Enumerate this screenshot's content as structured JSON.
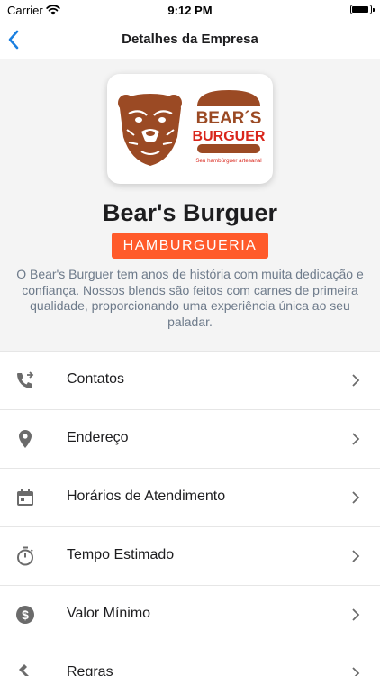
{
  "status_bar": {
    "carrier": "Carrier",
    "time": "9:12 PM",
    "battery_level": 0.92
  },
  "nav": {
    "title": "Detalhes da Empresa"
  },
  "logo": {
    "brand_line1": "BEAR´S",
    "brand_line2": "BURGUER",
    "tagline": "Seu hambúrguer artesanal"
  },
  "company": {
    "name": "Bear's Burguer",
    "category": "HAMBURGUERIA",
    "description": "O Bear's Burguer tem anos de história com muita dedicação e confiança. Nossos blends são feitos com carnes de primeira qualidade, proporcionando uma experiência única ao seu paladar."
  },
  "menu": {
    "items": [
      {
        "label": "Contatos",
        "icon": "phone-forward-icon"
      },
      {
        "label": "Endereço",
        "icon": "location-pin-icon"
      },
      {
        "label": "Horários de Atendimento",
        "icon": "calendar-icon"
      },
      {
        "label": "Tempo Estimado",
        "icon": "timer-icon"
      },
      {
        "label": "Valor Mínimo",
        "icon": "dollar-circle-icon"
      },
      {
        "label": "Regras",
        "icon": "gavel-icon"
      }
    ]
  },
  "colors": {
    "accent": "#ff5a2a",
    "brand_brown": "#9b4a24",
    "brand_red": "#d9261c",
    "back_blue": "#1a7fe0",
    "icon_gray": "#6b6b6b"
  }
}
